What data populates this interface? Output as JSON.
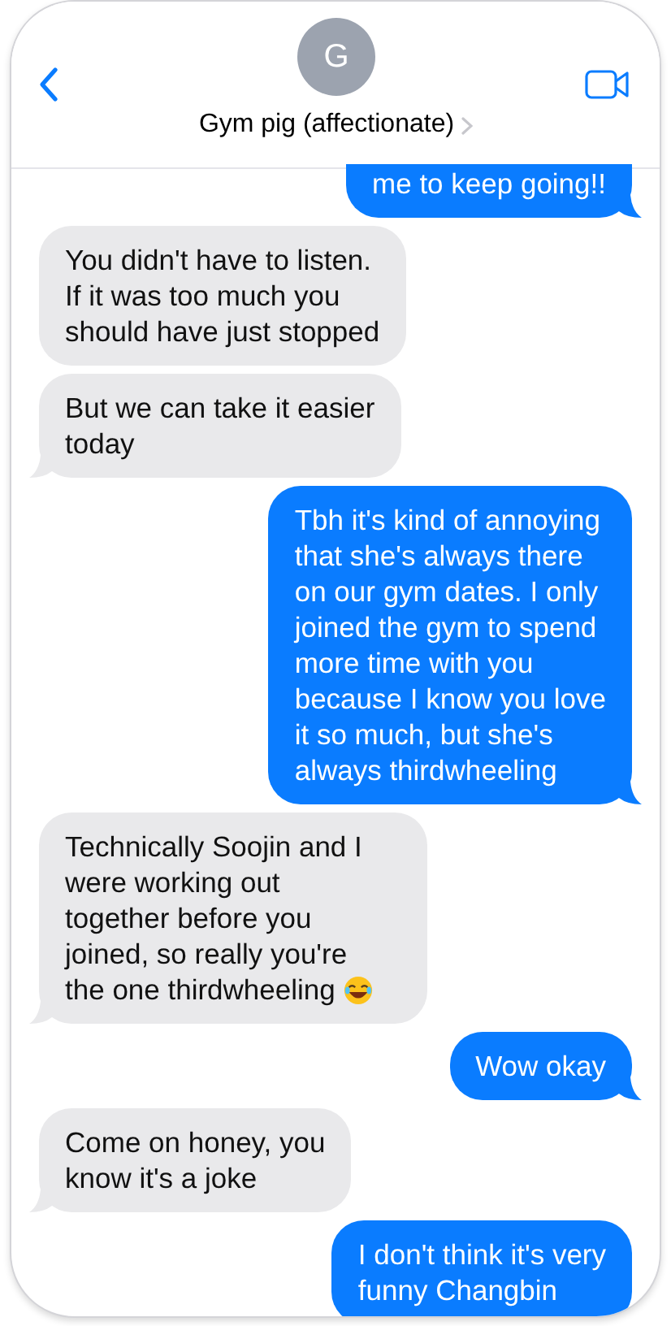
{
  "header": {
    "avatar_initial": "G",
    "contact_name": "Gym pig (affectionate)"
  },
  "messages": [
    {
      "kind": "sent",
      "lines": [
        "me to keep going!!"
      ],
      "tail": true,
      "cut_top": true,
      "trailing_icon": false
    },
    {
      "kind": "received",
      "lines": [
        "You didn't have to listen.",
        "If it was too much you",
        "should have just stopped"
      ],
      "tail": false,
      "cut_top": false,
      "trailing_icon": false
    },
    {
      "kind": "received",
      "lines": [
        "But we can take it easier",
        "today"
      ],
      "tail": true,
      "cut_top": false,
      "trailing_icon": false
    },
    {
      "kind": "sent",
      "lines": [
        "Tbh it's kind of annoying",
        "that she's always there",
        "on our gym dates. I only",
        "joined the gym to spend",
        "more time with you",
        "because I know you love",
        "it so much, but she's",
        "always thirdwheeling"
      ],
      "tail": true,
      "cut_top": false,
      "trailing_icon": false
    },
    {
      "kind": "received",
      "lines": [
        "Technically Soojin and I",
        "were working out",
        "together before you",
        "joined, so really you're",
        "the one thirdwheeling"
      ],
      "tail": true,
      "cut_top": false,
      "trailing_icon": true
    },
    {
      "kind": "sent",
      "lines": [
        "Wow okay"
      ],
      "tail": true,
      "cut_top": false,
      "trailing_icon": false
    },
    {
      "kind": "received",
      "lines": [
        "Come on honey, you",
        "know it's a joke"
      ],
      "tail": true,
      "cut_top": false,
      "trailing_icon": false
    },
    {
      "kind": "sent",
      "lines": [
        "I don't think it's very",
        "funny Changbin"
      ],
      "tail": false,
      "cut_top": false,
      "trailing_icon": false
    }
  ]
}
